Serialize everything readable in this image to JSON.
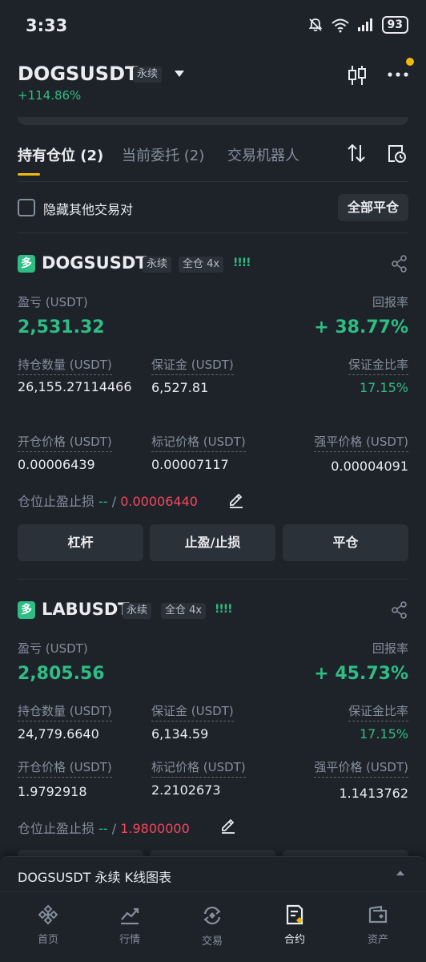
{
  "status_bar": {
    "time": "3:33",
    "battery": "93"
  },
  "header": {
    "symbol": "DOGSUSDT",
    "contract_type": "永续",
    "change": "+114.86%"
  },
  "tabs": [
    {
      "label": "持有仓位 (2)"
    },
    {
      "label": "当前委托 (2)"
    },
    {
      "label": "交易机器人"
    }
  ],
  "hide_others_label": "隐藏其他交易对",
  "close_all_label": "全部平仓",
  "field_labels": {
    "pnl": "盈亏 (USDT)",
    "roi": "回报率",
    "size": "持仓数量 (USDT)",
    "margin": "保证金 (USDT)",
    "margin_ratio": "保证金比率",
    "entry_price": "开仓价格 (USDT)",
    "mark_price": "标记价格 (USDT)",
    "liq_price": "强平价格 (USDT)",
    "tpsl": "仓位止盈止损",
    "tp_value": "--",
    "separator": "/"
  },
  "buttons": {
    "leverage": "杠杆",
    "tpsl": "止盈/止损",
    "close": "平仓"
  },
  "positions": [
    {
      "side": "多",
      "symbol": "DOGSUSDT",
      "contract": "永续",
      "mode": "全仓 4x",
      "signal": "!!!!",
      "pnl": "2,531.32",
      "roi": "+ 38.77%",
      "size": "26,155.27114466",
      "margin": "6,527.81",
      "margin_ratio": "17.15%",
      "entry_price": "0.00006439",
      "mark_price": "0.00007117",
      "liq_price": "0.00004091",
      "sl_value": "0.00006440"
    },
    {
      "side": "多",
      "symbol": "LABUSDT",
      "contract": "永续",
      "mode": "全仓 4x",
      "signal": "!!!!",
      "pnl": "2,805.56",
      "roi": "+ 45.73%",
      "size": "24,779.6640",
      "margin": "6,134.59",
      "margin_ratio": "17.15%",
      "entry_price": "1.9792918",
      "mark_price": "2.2102673",
      "liq_price": "1.1413762",
      "sl_value": "1.9800000"
    }
  ],
  "chart_bar": {
    "label": "DOGSUSDT 永续 K线图表"
  },
  "nav": [
    {
      "label": "首页"
    },
    {
      "label": "行情"
    },
    {
      "label": "交易"
    },
    {
      "label": "合约"
    },
    {
      "label": "资产"
    }
  ],
  "colors": {
    "positive": "#2ebd85",
    "negative": "#f6465d",
    "accent": "#f0b90b",
    "background": "#1e2329",
    "surface": "#2b3139"
  },
  "icons": [
    "bell-off-icon",
    "wifi-icon",
    "signal-icon",
    "battery-icon",
    "dropdown-icon",
    "candlestick-icon",
    "more-icon",
    "sort-icon",
    "order-history-icon",
    "share-icon",
    "edit-icon",
    "caret-up-icon",
    "home-icon",
    "markets-icon",
    "trade-icon",
    "futures-icon",
    "assets-icon"
  ]
}
